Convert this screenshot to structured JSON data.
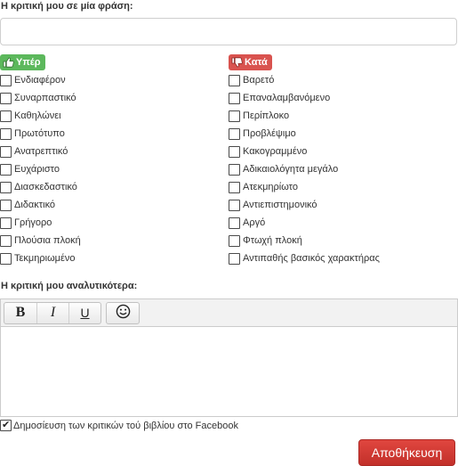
{
  "review_form": {
    "phrase_label": "Η κριτική μου σε μία φράση:",
    "phrase_value": "",
    "pros": {
      "title": "Υπέρ",
      "icon": "thumbs-up-icon",
      "color": "#5cb85c",
      "items": [
        {
          "label": "Ενδιαφέρον",
          "checked": false
        },
        {
          "label": "Συναρπαστικό",
          "checked": false
        },
        {
          "label": "Καθηλώνει",
          "checked": false
        },
        {
          "label": "Πρωτότυπο",
          "checked": false
        },
        {
          "label": "Ανατρεπτικό",
          "checked": false
        },
        {
          "label": "Ευχάριστο",
          "checked": false
        },
        {
          "label": "Διασκεδαστικό",
          "checked": false
        },
        {
          "label": "Διδακτικό",
          "checked": false
        },
        {
          "label": "Γρήγορο",
          "checked": false
        },
        {
          "label": "Πλούσια πλοκή",
          "checked": false
        },
        {
          "label": "Τεκμηριωμένο",
          "checked": false
        }
      ]
    },
    "cons": {
      "title": "Κατά",
      "icon": "thumbs-down-icon",
      "color": "#d9534f",
      "items": [
        {
          "label": "Βαρετό",
          "checked": false
        },
        {
          "label": "Επαναλαμβανόμενο",
          "checked": false
        },
        {
          "label": "Περίπλοκο",
          "checked": false
        },
        {
          "label": "Προβλέψιμο",
          "checked": false
        },
        {
          "label": "Κακογραμμένο",
          "checked": false
        },
        {
          "label": "Αδικαιολόγητα μεγάλο",
          "checked": false
        },
        {
          "label": "Ατεκμηρίωτο",
          "checked": false
        },
        {
          "label": "Αντιεπιστημονικό",
          "checked": false
        },
        {
          "label": "Αργό",
          "checked": false
        },
        {
          "label": "Φτωχή πλοκή",
          "checked": false
        },
        {
          "label": "Αντιπαθής βασικός χαρακτήρας",
          "checked": false
        }
      ]
    },
    "detail_label": "Η κριτική μου αναλυτικότερα:",
    "editor": {
      "toolbar": {
        "bold": "B",
        "italic": "I",
        "underline": "U",
        "emoji_icon": "smiley-icon"
      },
      "content": ""
    },
    "facebook_share": {
      "label": "Δημοσίευση των κριτικών τού βιβλίου στο Facebook",
      "checked": true
    },
    "save_label": "Αποθήκευση",
    "save_color": "#d9534f"
  }
}
